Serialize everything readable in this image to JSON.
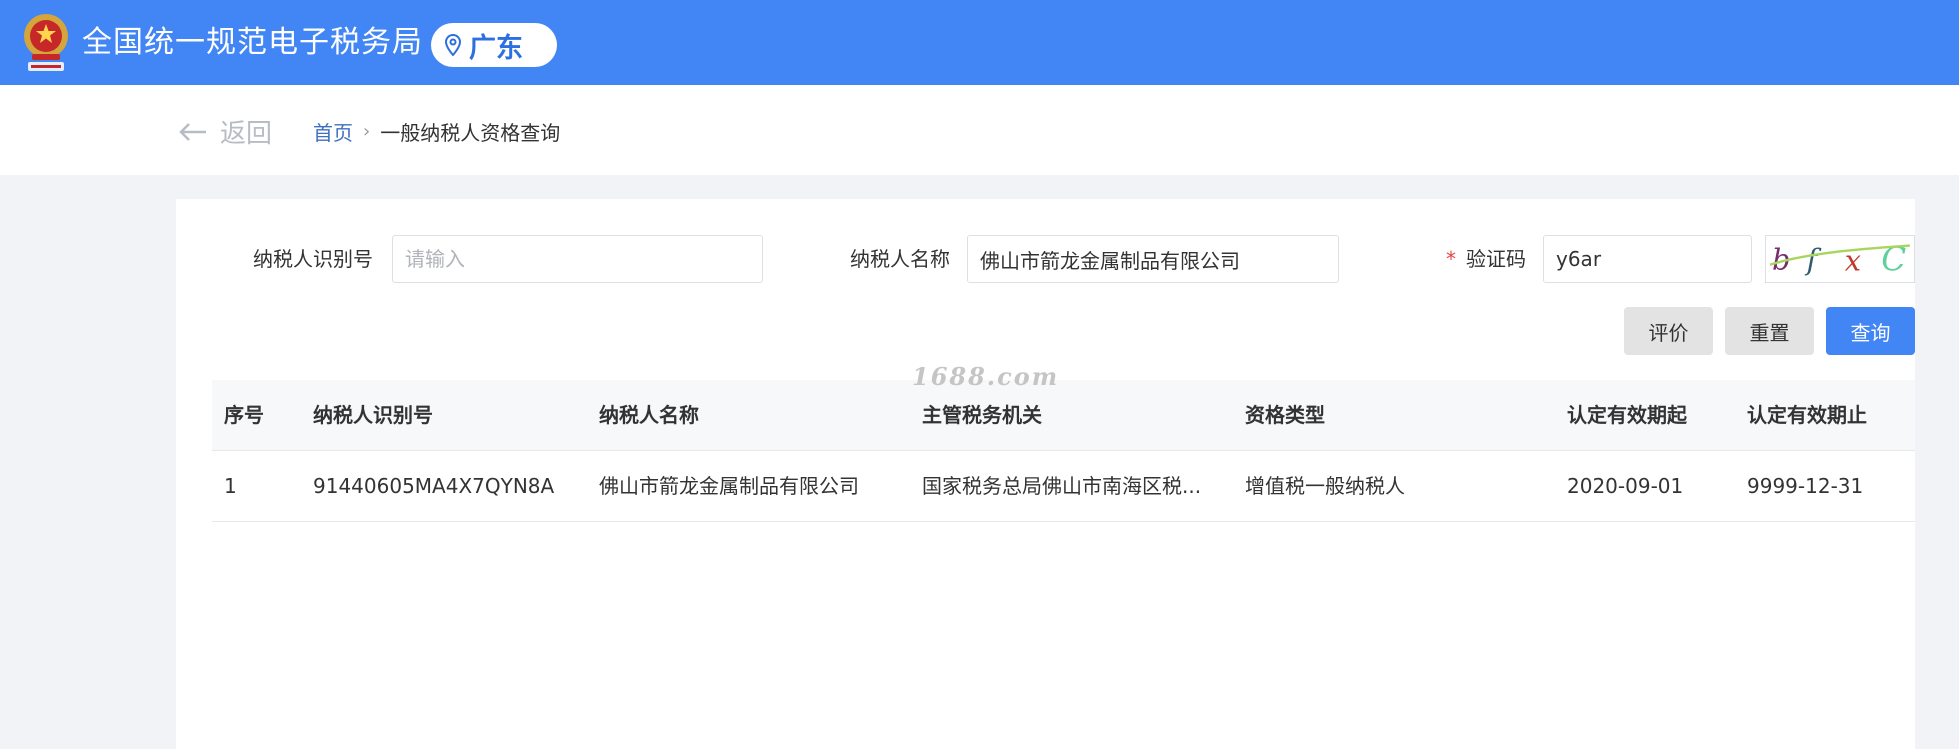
{
  "header": {
    "title": "全国统一规范电子税务局",
    "region": "广东",
    "brand_color": "#4285f4"
  },
  "nav": {
    "back_label": "返回",
    "breadcrumb": {
      "home": "首页",
      "separator": "›",
      "current": "一般纳税人资格查询"
    }
  },
  "form": {
    "taxpayer_id": {
      "label": "纳税人识别号",
      "value": "",
      "placeholder": "请输入"
    },
    "taxpayer_name": {
      "label": "纳税人名称",
      "value": "佛山市箭龙金属制品有限公司",
      "placeholder": "请输入"
    },
    "captcha": {
      "required_mark": "*",
      "label": "验证码",
      "value": "y6ar",
      "image_text": [
        "b",
        "f",
        "x",
        "C"
      ]
    }
  },
  "buttons": {
    "evaluate": "评价",
    "reset": "重置",
    "query": "查询"
  },
  "watermark": "1688.com",
  "table": {
    "columns": [
      "序号",
      "纳税人识别号",
      "纳税人名称",
      "主管税务机关",
      "资格类型",
      "认定有效期起",
      "认定有效期止"
    ],
    "rows": [
      [
        "1",
        "91440605MA4X7QYN8A",
        "佛山市箭龙金属制品有限公司",
        "国家税务总局佛山市南海区税...",
        "增值税一般纳税人",
        "2020-09-01",
        "9999-12-31"
      ]
    ]
  }
}
